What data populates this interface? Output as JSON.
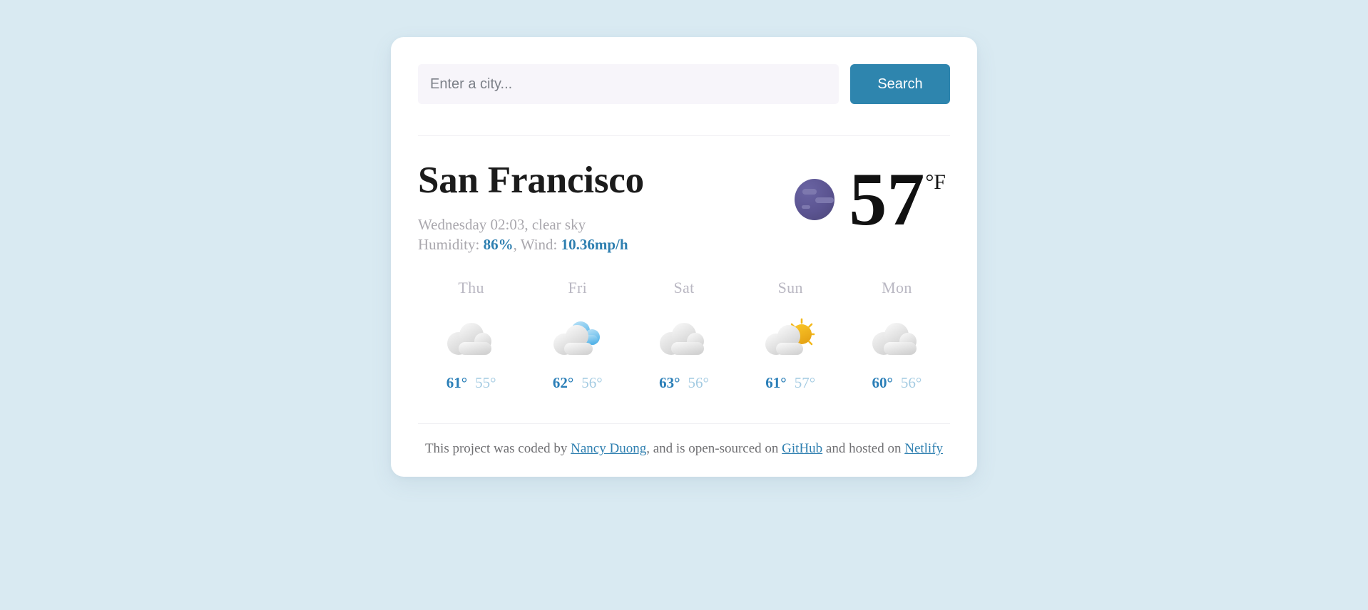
{
  "search": {
    "placeholder": "Enter a city...",
    "value": "",
    "button_label": "Search"
  },
  "current": {
    "city": "San Francisco",
    "datetime_description": "Wednesday 02:03, clear sky",
    "humidity_label": "Humidity: ",
    "humidity_value": "86%",
    "separator": ", ",
    "wind_label": "Wind: ",
    "wind_value": "10.36mp/h",
    "temperature": "57",
    "unit": "°F",
    "icon": "moon-icon"
  },
  "forecast": [
    {
      "day": "Thu",
      "icon": "cloud-icon",
      "max": "61°",
      "min": "55°"
    },
    {
      "day": "Fri",
      "icon": "cloud-blue-icon",
      "max": "62°",
      "min": "56°"
    },
    {
      "day": "Sat",
      "icon": "cloud-icon",
      "max": "63°",
      "min": "56°"
    },
    {
      "day": "Sun",
      "icon": "sun-behind-cloud-icon",
      "max": "61°",
      "min": "57°"
    },
    {
      "day": "Mon",
      "icon": "cloud-icon",
      "max": "60°",
      "min": "56°"
    }
  ],
  "footer": {
    "text_1": "This project was coded by ",
    "link_author": "Nancy Duong",
    "text_2": ", and is open-sourced on ",
    "link_source": "GitHub",
    "text_3": " and hosted on ",
    "link_host": "Netlify"
  },
  "colors": {
    "page_background": "#d9eaf2",
    "card_background": "#ffffff",
    "accent_blue": "#2e85ae",
    "value_blue": "#2e7fb0",
    "temp_max": "#2b7fb8",
    "temp_min": "#a4cbe2",
    "muted_text": "#a9a7ad",
    "moon_purple": "#5b5491"
  }
}
